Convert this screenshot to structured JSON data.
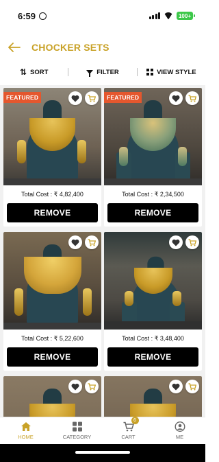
{
  "status_bar": {
    "time": "6:59",
    "battery": "100+"
  },
  "header": {
    "title": "CHOCKER SETS"
  },
  "toolbar": {
    "sort_label": "SORT",
    "filter_label": "FILTER",
    "view_label": "VIEW STYLE"
  },
  "products": [
    {
      "badge": "FEATURED",
      "total_cost": "Total Cost : ₹ 4,82,400",
      "remove_label": "REMOVE"
    },
    {
      "badge": "FEATURED",
      "total_cost": "Total Cost : ₹ 2,34,500",
      "remove_label": "REMOVE"
    },
    {
      "badge": "",
      "total_cost": "Total Cost : ₹ 5,22,600",
      "remove_label": "REMOVE"
    },
    {
      "badge": "",
      "total_cost": "Total Cost : ₹ 3,48,400",
      "remove_label": "REMOVE"
    }
  ],
  "bottom_nav": {
    "home": "HOME",
    "category": "CATEGORY",
    "cart": "CART",
    "cart_count": "6",
    "me": "ME"
  },
  "colors": {
    "accent": "#c9a227",
    "badge": "#e4572e",
    "button": "#000000"
  },
  "icons": [
    "back-arrow-icon",
    "sort-icon",
    "filter-icon",
    "grid-icon",
    "heart-icon",
    "cart-icon",
    "home-icon",
    "category-icon",
    "profile-icon"
  ]
}
